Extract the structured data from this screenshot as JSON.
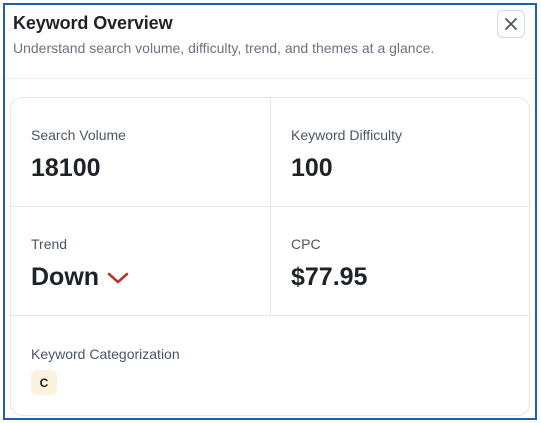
{
  "header": {
    "title": "Keyword Overview",
    "subtitle": "Understand search volume, difficulty, trend, and themes at a glance.",
    "close_icon": "close-icon"
  },
  "metrics": {
    "search_volume": {
      "label": "Search Volume",
      "value": "18100"
    },
    "keyword_difficulty": {
      "label": "Keyword Difficulty",
      "value": "100"
    },
    "trend": {
      "label": "Trend",
      "value": "Down",
      "icon": "chevron-down-icon",
      "icon_color": "#b3372b"
    },
    "cpc": {
      "label": "CPC",
      "value": "$77.95"
    }
  },
  "categorization": {
    "label": "Keyword Categorization",
    "badges": [
      "C"
    ],
    "badge_color": "#fbf3de"
  },
  "colors": {
    "frame_border": "#1f5fa8",
    "text_primary": "#1f2328",
    "text_secondary": "#6b7280"
  }
}
